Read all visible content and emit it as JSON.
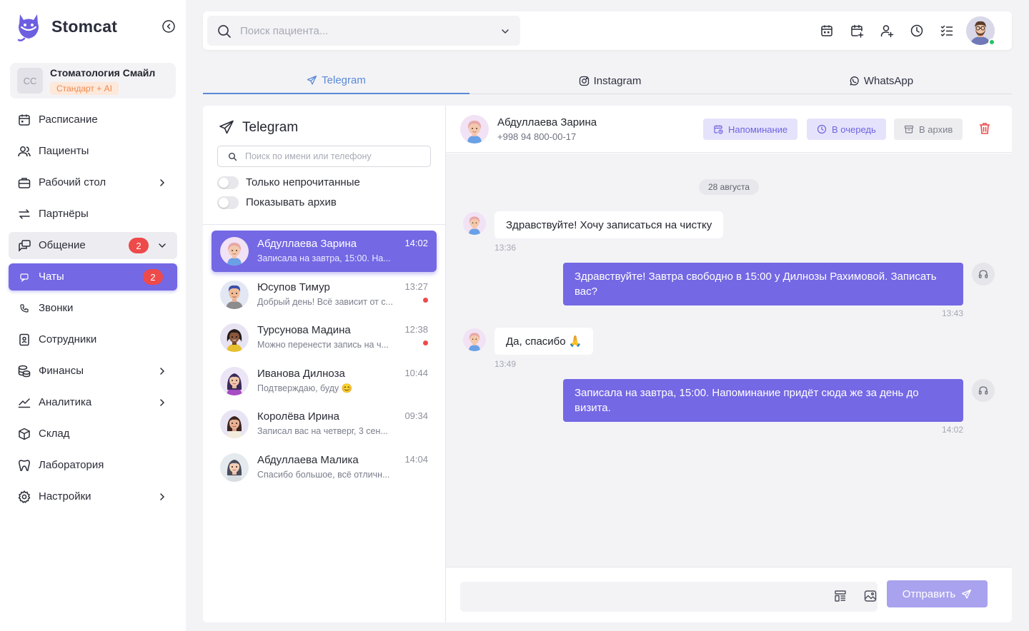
{
  "brand": {
    "name": "Stomcat"
  },
  "clinic": {
    "initials": "СС",
    "name": "Стоматология Смайл",
    "plan": "Стандарт + AI"
  },
  "sidebar": {
    "items": [
      {
        "label": "Расписание",
        "icon": "calendar-icon"
      },
      {
        "label": "Пациенты",
        "icon": "users-icon"
      },
      {
        "label": "Рабочий стол",
        "icon": "briefcase-icon",
        "has_submenu": true
      },
      {
        "label": "Партнёры",
        "icon": "arrows-icon"
      },
      {
        "label": "Общение",
        "icon": "chat-icon",
        "badge": "2",
        "expanded": true
      },
      {
        "label": "Чаты",
        "icon": "chat-small-icon",
        "badge": "2",
        "active": true
      },
      {
        "label": "Звонки",
        "icon": "phone-icon"
      },
      {
        "label": "Сотрудники",
        "icon": "badge-icon"
      },
      {
        "label": "Финансы",
        "icon": "coins-icon",
        "has_submenu": true
      },
      {
        "label": "Аналитика",
        "icon": "chart-icon",
        "has_submenu": true
      },
      {
        "label": "Склад",
        "icon": "box-icon"
      },
      {
        "label": "Лаборатория",
        "icon": "tooth-icon"
      },
      {
        "label": "Настройки",
        "icon": "gear-icon",
        "has_submenu": true
      }
    ]
  },
  "topbar": {
    "search_placeholder": "Поиск пациента...",
    "icons": [
      "calendar-icon",
      "calendar-plus-icon",
      "user-plus-icon",
      "clock-icon",
      "checklist-icon"
    ],
    "user_status": "online"
  },
  "channel_tabs": [
    {
      "label": "Telegram",
      "icon": "telegram-icon",
      "active": true
    },
    {
      "label": "Instagram",
      "icon": "instagram-icon"
    },
    {
      "label": "WhatsApp",
      "icon": "whatsapp-icon"
    }
  ],
  "chat_list": {
    "title": "Telegram",
    "search_placeholder": "Поиск по имени или телефону",
    "toggles": [
      {
        "label": "Только непрочитанные",
        "on": false
      },
      {
        "label": "Показывать архив",
        "on": false
      }
    ],
    "chats": [
      {
        "name": "Абдуллаева Зарина",
        "preview": "Записала на завтра, 15:00. На...",
        "time": "14:02",
        "unread": false,
        "active": true,
        "avatar": "woman-pink"
      },
      {
        "name": "Юсупов Тимур",
        "preview": "Добрый день! Всё зависит от с...",
        "time": "13:27",
        "unread": true,
        "active": false,
        "avatar": "man-curly"
      },
      {
        "name": "Турсунова Мадина",
        "preview": "Можно перенести запись на ч...",
        "time": "12:38",
        "unread": true,
        "active": false,
        "avatar": "woman-dark"
      },
      {
        "name": "Иванова Дилноза",
        "preview": "Подтверждаю, буду 😊",
        "time": "10:44",
        "unread": false,
        "active": false,
        "avatar": "woman-purple"
      },
      {
        "name": "Королёва Ирина",
        "preview": "Записал вас на четверг, 3 сен...",
        "time": "09:34",
        "unread": false,
        "active": false,
        "avatar": "woman-brown"
      },
      {
        "name": "Абдуллаева Малика",
        "preview": "Спасибо большое, всё отличн...",
        "time": "14:04",
        "unread": false,
        "active": false,
        "avatar": "woman-gray"
      }
    ]
  },
  "conversation": {
    "contact_name": "Абдуллаева Зарина",
    "contact_phone": "+998 94 800-00-17",
    "actions": {
      "reminder": "Напоминание",
      "queue": "В очередь",
      "archive": "В архив"
    },
    "date_separator": "28 августа",
    "messages": [
      {
        "direction": "in",
        "text": "Здравствуйте! Хочу записаться на чистку",
        "time": "13:36"
      },
      {
        "direction": "out",
        "text": "Здравствуйте! Завтра свободно в 15:00 у Дилнозы Рахимовой. Записать вас?",
        "time": "13:43"
      },
      {
        "direction": "in",
        "text": "Да, спасибо 🙏",
        "time": "13:49"
      },
      {
        "direction": "out",
        "text": "Записала на завтра, 15:00. Напоминание придёт сюда же за день до визита.",
        "time": "14:02"
      }
    ],
    "composer": {
      "placeholder": "",
      "send_label": "Отправить"
    }
  },
  "colors": {
    "accent": "#7468e4",
    "link": "#5b8ad6",
    "badge": "#ee4a4a",
    "plan": "#ee8a4c"
  }
}
